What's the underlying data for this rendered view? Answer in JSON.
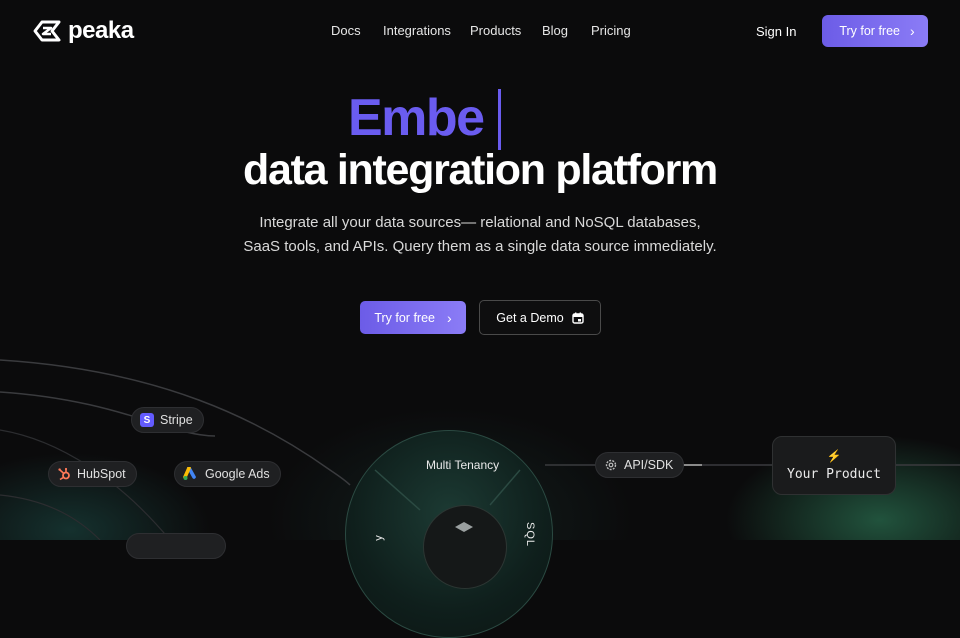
{
  "brand": {
    "name": "peaka"
  },
  "nav": {
    "items": [
      "Docs",
      "Integrations",
      "Products",
      "Blog",
      "Pricing"
    ],
    "sign_in": "Sign In",
    "cta": "Try for free"
  },
  "hero": {
    "typed_text": "Embe",
    "title": "data integration platform",
    "description": "Integrate all your data sources— relational and NoSQL databases, SaaS tools, and APIs. Query them as a single data source immediately.",
    "primary_cta": "Try for free",
    "secondary_cta": "Get a Demo"
  },
  "diagram": {
    "sources": [
      {
        "label": "Stripe",
        "icon": "stripe-icon"
      },
      {
        "label": "HubSpot",
        "icon": "hubspot-icon"
      },
      {
        "label": "Google Ads",
        "icon": "google-ads-icon"
      }
    ],
    "hub_top_label": "Multi Tenancy",
    "hub_right_label": "SQL",
    "hub_left_label": "y",
    "connector_label": "API/SDK",
    "target_label": "Your Product",
    "target_icon": "lightning-icon"
  },
  "colors": {
    "accent": "#6c5ce7",
    "background": "#0b0b0c",
    "glow": "#3caa78"
  }
}
